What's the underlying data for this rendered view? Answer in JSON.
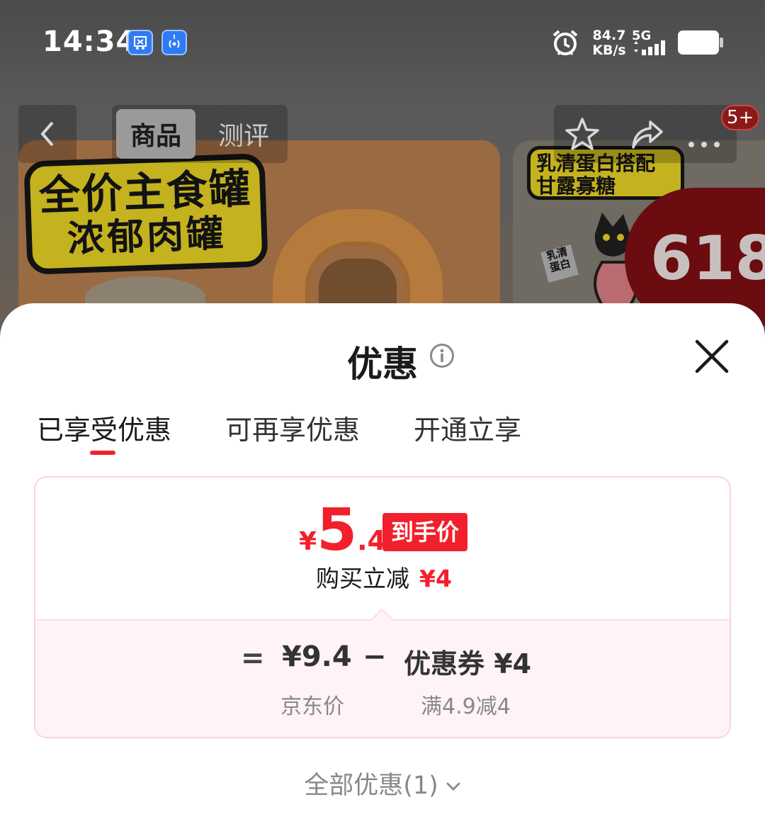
{
  "status_bar": {
    "time": "14:34",
    "net_speed_value": "84.7",
    "net_speed_unit": "KB/s",
    "network_type": "5G"
  },
  "nav": {
    "tabs": [
      {
        "label": "商品",
        "active": true
      },
      {
        "label": "测评",
        "active": false
      }
    ],
    "cart_badge": "5+"
  },
  "banner": {
    "main_sticker_line1": "全价主食罐",
    "main_sticker_line2": "浓郁肉罐",
    "side_sticker_line1": "乳清蛋白搭配",
    "side_sticker_line2": "甘露寡糖",
    "side_small_tag": "乳清蛋白",
    "promo_text": "618"
  },
  "sheet": {
    "title": "优惠",
    "tabs": [
      {
        "label": "已享受优惠",
        "active": true
      },
      {
        "label": "可再享优惠",
        "active": false
      },
      {
        "label": "开通立享",
        "active": false
      }
    ],
    "card": {
      "currency": "¥",
      "price_int": "5",
      "price_dec": ".4",
      "price_tag": "到手价",
      "saving_label": "购买立减",
      "saving_amount": "¥4",
      "equals": "=",
      "jd_price": "¥9.4",
      "minus": "−",
      "coupon_label": "优惠券 ¥4",
      "jd_price_label": "京东价",
      "coupon_condition": "满4.9减4"
    },
    "all_offers": "全部优惠(1)"
  },
  "colors": {
    "accent_red": "#f2202c",
    "card_border": "#fbd3dc",
    "card_tint": "#fff3f5"
  }
}
